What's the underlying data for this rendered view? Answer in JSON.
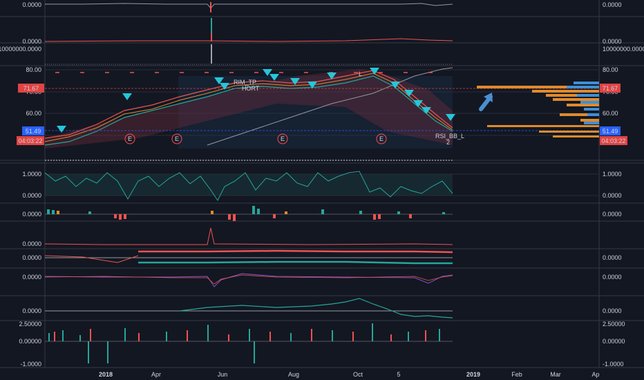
{
  "colors": {
    "background": "#131722",
    "panel_border": "#363a45",
    "grid": "#2a2e39",
    "price_badge_red": "#e04343",
    "price_badge_blue": "#2962ff",
    "bull": "#26a69a",
    "bear": "#ef5350",
    "orange": "#e08a2c",
    "volume_profile_blue": "#3f8fd6",
    "arrow_blue": "#4a8fd1"
  },
  "panes": [
    {
      "id": "pane-top",
      "left_ticks": [
        "0.0000"
      ],
      "right_ticks": [
        "0.0000"
      ]
    },
    {
      "id": "pane-2",
      "left_ticks": [
        "0.0000"
      ],
      "right_ticks": [
        "0.0000"
      ]
    },
    {
      "id": "pane-3",
      "left_ticks": [
        "10000000.0000"
      ],
      "right_ticks": [
        "10000000.0000"
      ]
    },
    {
      "id": "pane-main",
      "left_ticks": [
        "80.00",
        "70.00",
        "60.00"
      ],
      "right_ticks": [
        "80.00",
        "70.00",
        "60.00"
      ]
    },
    {
      "id": "pane-osc",
      "left_ticks": [
        "1.0000",
        "0.0000"
      ],
      "right_ticks": [
        "1.0000",
        "0.0000"
      ]
    },
    {
      "id": "pane-macd",
      "left_ticks": [
        "0.0000"
      ],
      "right_ticks": [
        "0.0000"
      ]
    },
    {
      "id": "pane-7",
      "left_ticks": [
        "0.0000"
      ],
      "right_ticks": []
    },
    {
      "id": "pane-8",
      "left_ticks": [
        "0.0000"
      ],
      "right_ticks": [
        "0.0000"
      ]
    },
    {
      "id": "pane-9",
      "left_ticks": [
        "0.0000"
      ],
      "right_ticks": [
        "0.0000"
      ]
    },
    {
      "id": "pane-10",
      "left_ticks": [
        "0.0000"
      ],
      "right_ticks": [
        "0.0000"
      ]
    },
    {
      "id": "pane-bottom",
      "left_ticks": [
        "2.50000",
        "0.00000",
        "-1.0000"
      ],
      "right_ticks": [
        "2.50000",
        "0.00000",
        "-1.0000"
      ]
    }
  ],
  "price_badges": {
    "last_high": "71.67",
    "last_price": "51.49",
    "countdown": "04:03:22"
  },
  "annotations": {
    "earnings_marker": "E",
    "label_rim": "RIM_TP",
    "label_short": "HORT",
    "label_rsi": "RSI_BB_L",
    "label_small": "2",
    "label_l": "L"
  },
  "time_axis": [
    "2018",
    "Apr",
    "Jun",
    "Aug",
    "Oct",
    "5",
    "2019",
    "Feb",
    "Mar",
    "Ap"
  ],
  "icons": {
    "arrow": "arrow-up-right-icon"
  }
}
